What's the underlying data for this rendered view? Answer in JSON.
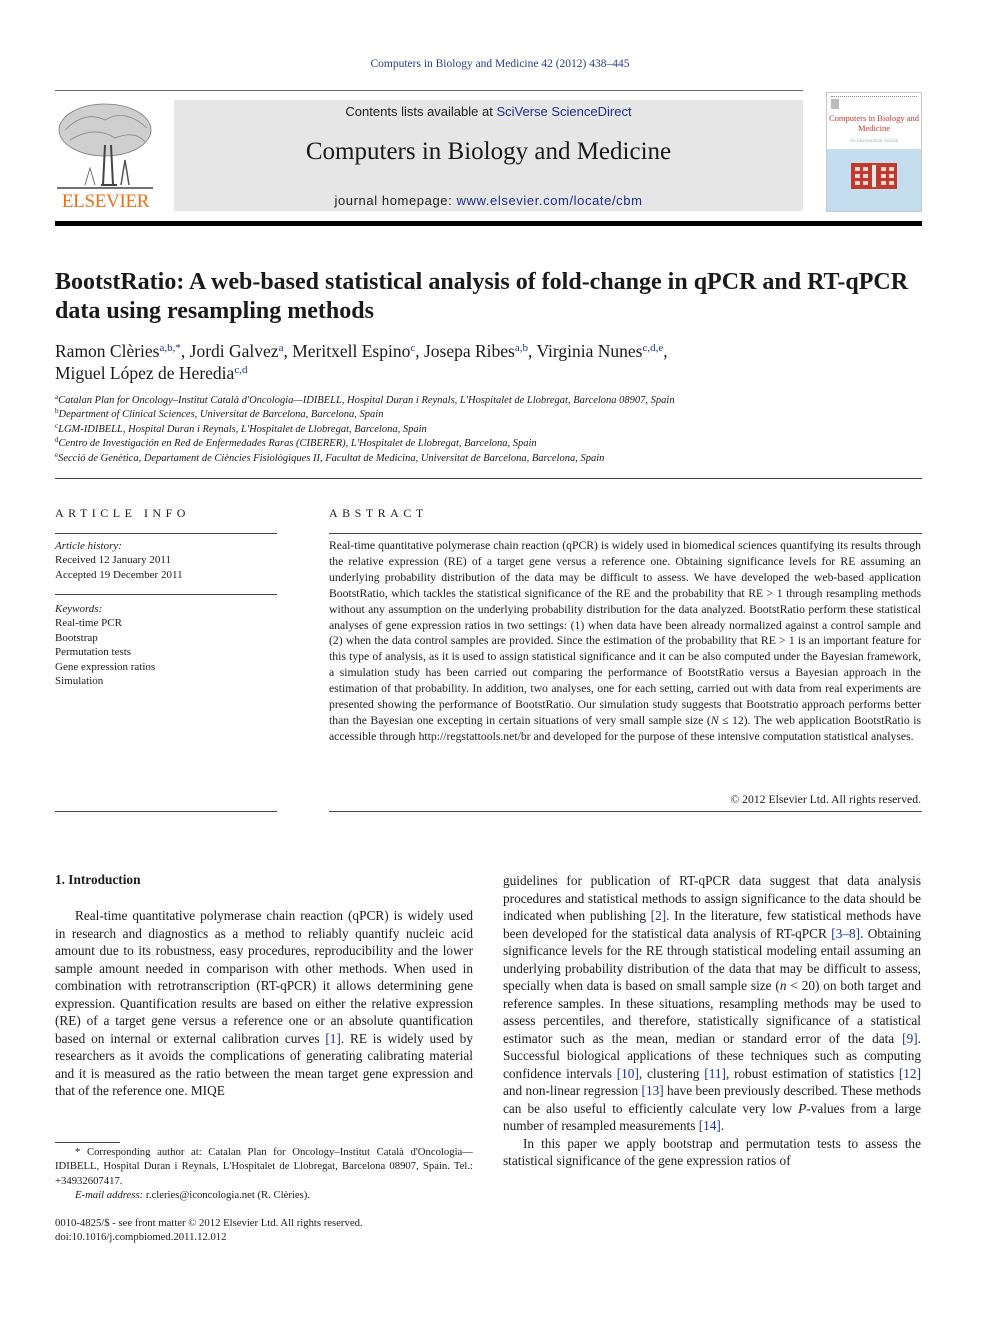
{
  "journal": {
    "citation": "Computers in Biology and Medicine 42 (2012) 438–445",
    "publisher_logo_text": "ELSEVIER",
    "contents_prefix": "Contents lists available at ",
    "contents_link": "SciVerse ScienceDirect",
    "title": "Computers in Biology and Medicine",
    "homepage_prefix": "journal homepage: ",
    "homepage_link": "www.elsevier.com/locate/cbm",
    "cover_title": "Computers in Biology and Medicine",
    "cover_subtitle": "An International Journal",
    "colors": {
      "link": "#1e2f8f",
      "logo": "#e8701a",
      "cover_red": "#c0392b",
      "cover_blue": "#c3dcee",
      "header_bg": "#e6e6e6"
    }
  },
  "article": {
    "title": "BootstRatio: A web-based statistical analysis of fold-change in qPCR and RT-qPCR data using resampling methods",
    "authors": [
      {
        "name": "Ramon Clèries",
        "affil": "a,b,*",
        "sep": ", "
      },
      {
        "name": "Jordi Galvez",
        "affil": "a",
        "sep": ", "
      },
      {
        "name": "Meritxell Espino",
        "affil": "c",
        "sep": ", "
      },
      {
        "name": "Josepa Ribes",
        "affil": "a,b",
        "sep": ", "
      },
      {
        "name": "Virginia Nunes",
        "affil": "c,d,e",
        "sep": ","
      },
      {
        "name": "Miguel López de Heredia",
        "affil": "c,d",
        "sep": ""
      }
    ],
    "affiliations": [
      {
        "key": "a",
        "text": "Catalan Plan for Oncology–Institut Català d'Oncologia—IDIBELL, Hospital Duran i Reynals, L'Hospitalet de Llobregat, Barcelona 08907, Spain"
      },
      {
        "key": "b",
        "text": "Department of Clinical Sciences, Universitat de Barcelona, Barcelona, Spain"
      },
      {
        "key": "c",
        "text": "LGM-IDIBELL, Hospital Duran i Reynals, L'Hospitalet de Llobregat, Barcelona, Spain"
      },
      {
        "key": "d",
        "text": "Centro de Investigación en Red de Enfermedades Raras (CIBERER), L'Hospitalet de Llobregat, Barcelona, Spain"
      },
      {
        "key": "e",
        "text": "Secció de Genètica, Departament de Ciències Fisiològiques II, Facultat de Medicina, Universitat de Barcelona, Barcelona, Spain"
      }
    ]
  },
  "article_info": {
    "heading": "ARTICLE INFO",
    "history_label": "Article history:",
    "received": "Received 12 January 2011",
    "accepted": "Accepted 19 December 2011",
    "keywords_label": "Keywords:",
    "keywords": [
      "Real-time PCR",
      "Bootstrap",
      "Permutation tests",
      "Gene expression ratios",
      "Simulation"
    ]
  },
  "abstract": {
    "heading": "ABSTRACT",
    "text_1": "Real-time quantitative polymerase chain reaction (qPCR) is widely used in biomedical sciences quantifying its results through the relative expression (RE) of a target gene versus a reference one. Obtaining significance levels for RE assuming an underlying probability distribution of the data may be difficult to assess. We have developed the web-based application BootstRatio, which tackles the statistical significance of the RE and the probability that RE > 1 through resampling methods without any assumption on the underlying probability distribution for the data analyzed. BootstRatio perform these statistical analyses of gene expression ratios in two settings: (1) when data have been already normalized against a control sample and (2) when the data control samples are provided. Since the estimation of the probability that RE > 1 is an important feature for this type of analysis, as it is used to assign statistical significance and it can be also computed under the Bayesian framework, a simulation study has been carried out comparing the performance of BootstRatio versus a Bayesian approach in the estimation of that probability. In addition, two analyses, one for each setting, carried out with data from real experiments are presented showing the performance of BootstRatio. Our simulation study suggests that Bootstratio approach performs better than the Bayesian one excepting in certain situations of very small sample size (",
    "n_symbol": "N",
    "text_2": " ≤ 12). The web application BootstRatio is accessible through http://regstattools.net/br and developed for the purpose of these intensive computation statistical analyses.",
    "copyright": "© 2012 Elsevier Ltd. All rights reserved."
  },
  "introduction": {
    "heading": "1.  Introduction",
    "left": {
      "p1a": "Real-time quantitative polymerase chain reaction (qPCR) is widely used in research and diagnostics as a method to reliably quantify nucleic acid amount due to its robustness, easy procedures, reproducibility and the lower sample amount needed in comparison with other methods. When used in combination with retrotranscription (RT-qPCR) it allows determining gene expression. Quantification results are based on either the relative expression (RE) of a target gene versus a reference one or an absolute quantification based on internal or external calibration curves ",
      "ref1": "[1]",
      "p1b": ". RE is widely used by researchers as it avoids the complications of generating calibrating material and it is measured as the ratio between the mean target gene expression and that of the reference one. MIQE"
    },
    "right": {
      "s1": "guidelines for publication of RT-qPCR data suggest that data analysis procedures and statistical methods to assign significance to the data should be indicated when publishing ",
      "ref2": "[2]",
      "s2": ". In the literature, few statistical methods have been developed for the statistical data analysis of RT-qPCR ",
      "ref3": "[3–8]",
      "s3": ". Obtaining significance levels for the RE through statistical modeling entail assuming an underlying probability distribution of the data that may be difficult to assess, specially when data is based on small sample size (",
      "n_symbol": "n",
      "s4": " < 20) on both target and reference samples. In these situations, resampling methods may be used to assess percentiles, and therefore, statistically significance of a statistical estimator such as the mean, median or standard error of the data ",
      "ref9": "[9]",
      "s5": ". Successful biological applications of these techniques such as computing confidence intervals ",
      "ref10": "[10]",
      "s6": ", clustering ",
      "ref11": "[11]",
      "s7": ", robust estimation of statistics ",
      "ref12": "[12]",
      "s8": " and non-linear regression ",
      "ref13": "[13]",
      "s9": " have been previously described. These methods can be also useful to efficiently calculate very low ",
      "p_symbol": "P",
      "s10": "-values from a large number of resampled measurements ",
      "ref14": "[14]",
      "s11": ".",
      "p2": "In this paper we apply bootstrap and permutation tests to assess the statistical significance of the gene expression ratios of"
    }
  },
  "footnotes": {
    "corresponding": "* Corresponding author at: Catalan Plan for Oncology–Institut Català d'Oncologia—IDIBELL, Hospital Duran i Reynals, L'Hospitalet de Llobregat, Barcelona 08907, Spain. Tel.: +34932607417.",
    "email_label": "E-mail address:",
    "email": " r.cleries@iconcologia.net (R. Clèries).",
    "issn": "0010-4825/$ - see front matter © 2012 Elsevier Ltd. All rights reserved.",
    "doi": "doi:10.1016/j.compbiomed.2011.12.012"
  }
}
